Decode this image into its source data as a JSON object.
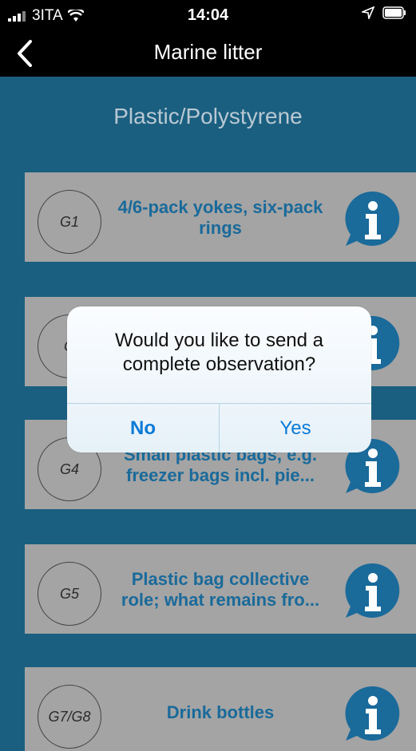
{
  "status_bar": {
    "carrier": "3ITA",
    "time": "14:04"
  },
  "nav": {
    "title": "Marine litter",
    "back_icon": "chevron-left-icon"
  },
  "section": {
    "title": "Plastic/Polystyrene"
  },
  "items": [
    {
      "code": "G1",
      "label": "4/6-pack yokes, six-pack rings"
    },
    {
      "code": "G",
      "label": ""
    },
    {
      "code": "G4",
      "label": "Small plastic bags, e.g. freezer bags incl. pie..."
    },
    {
      "code": "G5",
      "label": "Plastic bag collective role; what remains fro..."
    },
    {
      "code": "G7/G8",
      "label": "Drink bottles"
    }
  ],
  "dialog": {
    "message": "Would you like to send a complete observation?",
    "no_label": "No",
    "yes_label": "Yes"
  },
  "colors": {
    "background": "#1a5f80",
    "card": "#a4a4a4",
    "item_text": "#1a6a9a",
    "dialog_button": "#0a7ad6"
  }
}
